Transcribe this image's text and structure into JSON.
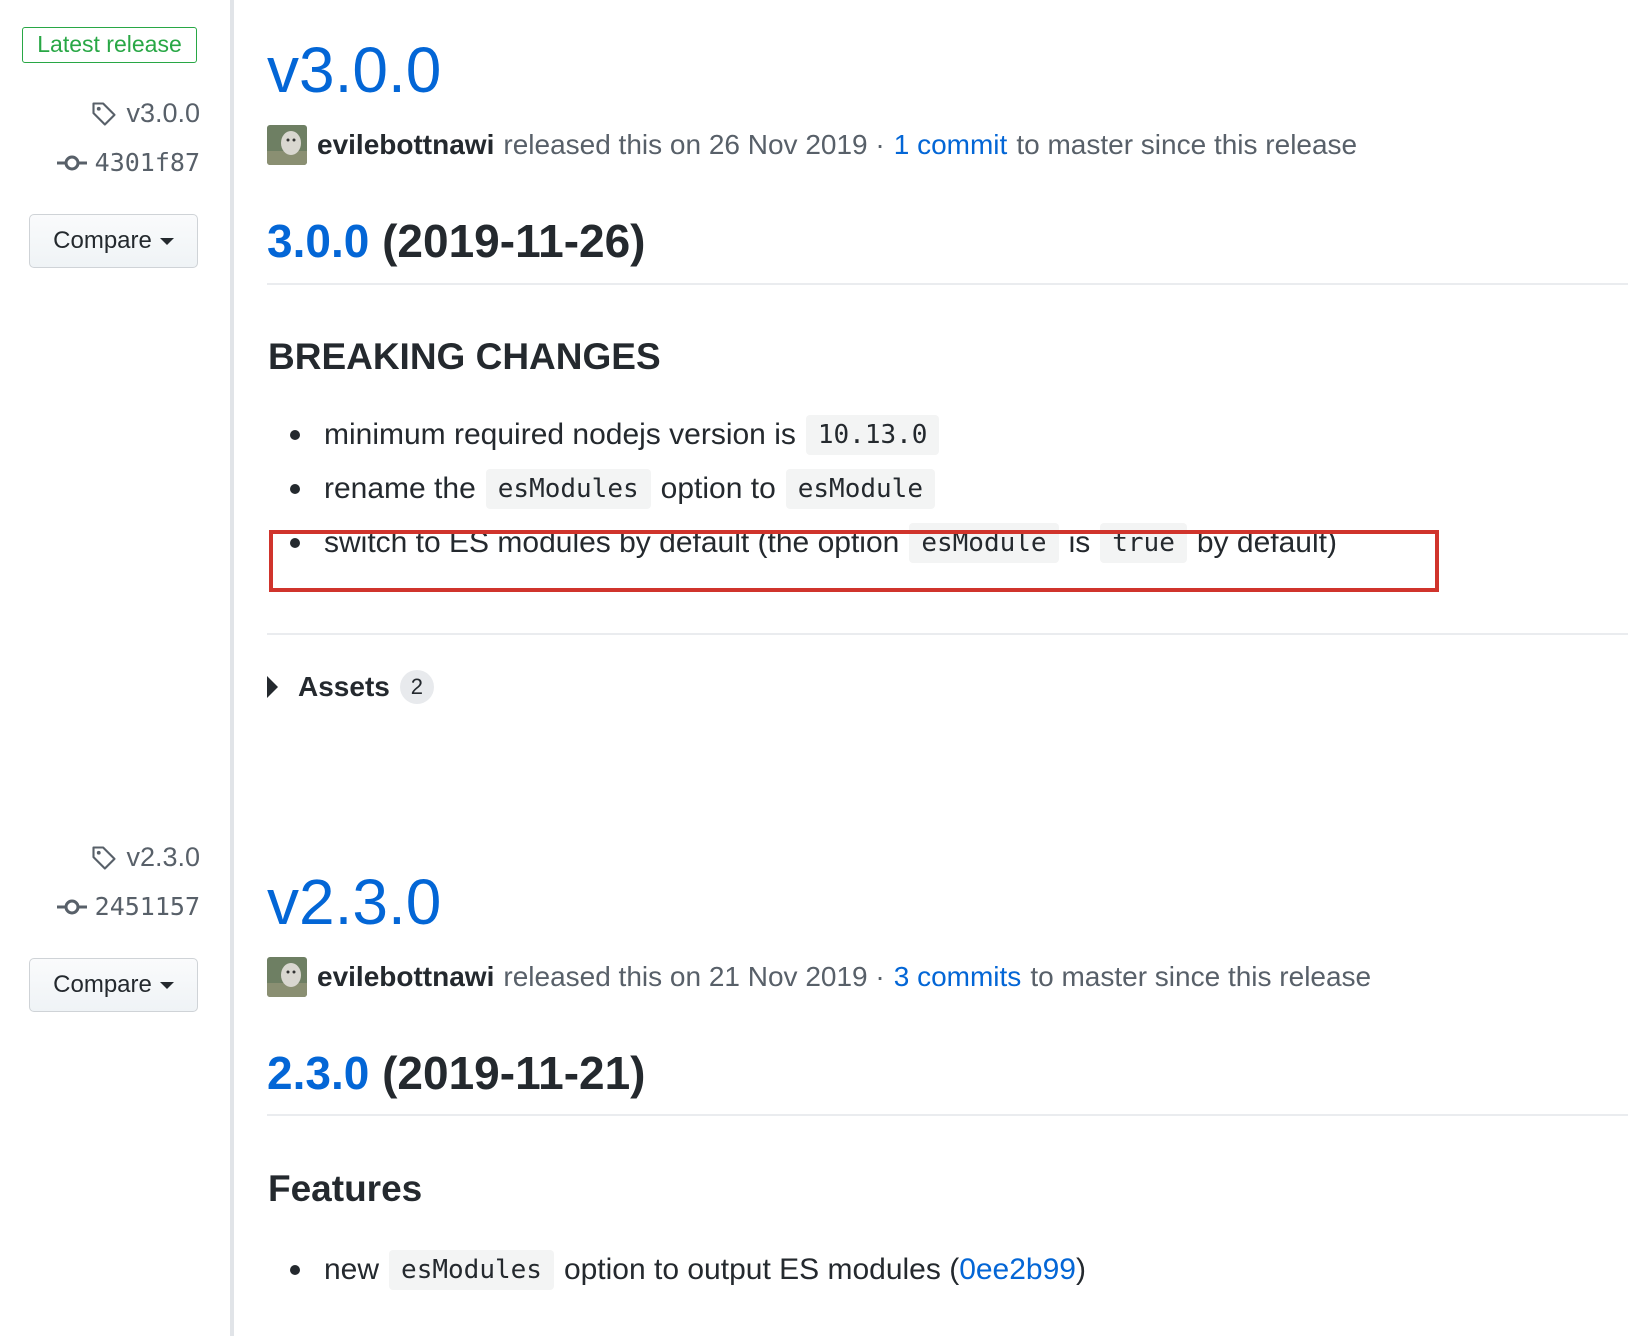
{
  "sidebar": {
    "latest_badge": "Latest release",
    "releases": [
      {
        "tag": "v3.0.0",
        "commit": "4301f87",
        "compare_label": "Compare"
      },
      {
        "tag": "v2.3.0",
        "commit": "2451157",
        "compare_label": "Compare"
      }
    ]
  },
  "releases": [
    {
      "title": "v3.0.0",
      "author": "evilebottnawi",
      "released_text": "released this on 26 Nov 2019 ·",
      "commits_link": "1 commit",
      "commits_suffix": "to master since this release",
      "version_link": "3.0.0",
      "version_date": "(2019-11-26)",
      "section_heading": "BREAKING CHANGES",
      "items": {
        "item1": {
          "text": "minimum required nodejs version is",
          "code": "10.13.0"
        },
        "item2": {
          "text_a": "rename the",
          "code_a": "esModules",
          "text_b": "option to",
          "code_b": "esModule"
        },
        "item3": {
          "text_a": "switch to ES modules by default (the option",
          "code_a": "esModule",
          "text_b": "is",
          "code_b": "true",
          "text_c": "by default)"
        }
      },
      "assets_label": "Assets",
      "assets_count": "2"
    },
    {
      "title": "v2.3.0",
      "author": "evilebottnawi",
      "released_text": "released this on 21 Nov 2019 ·",
      "commits_link": "3 commits",
      "commits_suffix": "to master since this release",
      "version_link": "2.3.0",
      "version_date": "(2019-11-21)",
      "section_heading": "Features",
      "items": {
        "item1": {
          "text_a": "new",
          "code": "esModules",
          "text_b": "option to output ES modules (",
          "link": "0ee2b99",
          "text_c": ")"
        }
      }
    }
  ],
  "colors": {
    "link": "#0366d6",
    "badge_green": "#28a745",
    "highlight_red": "#d0342c"
  }
}
